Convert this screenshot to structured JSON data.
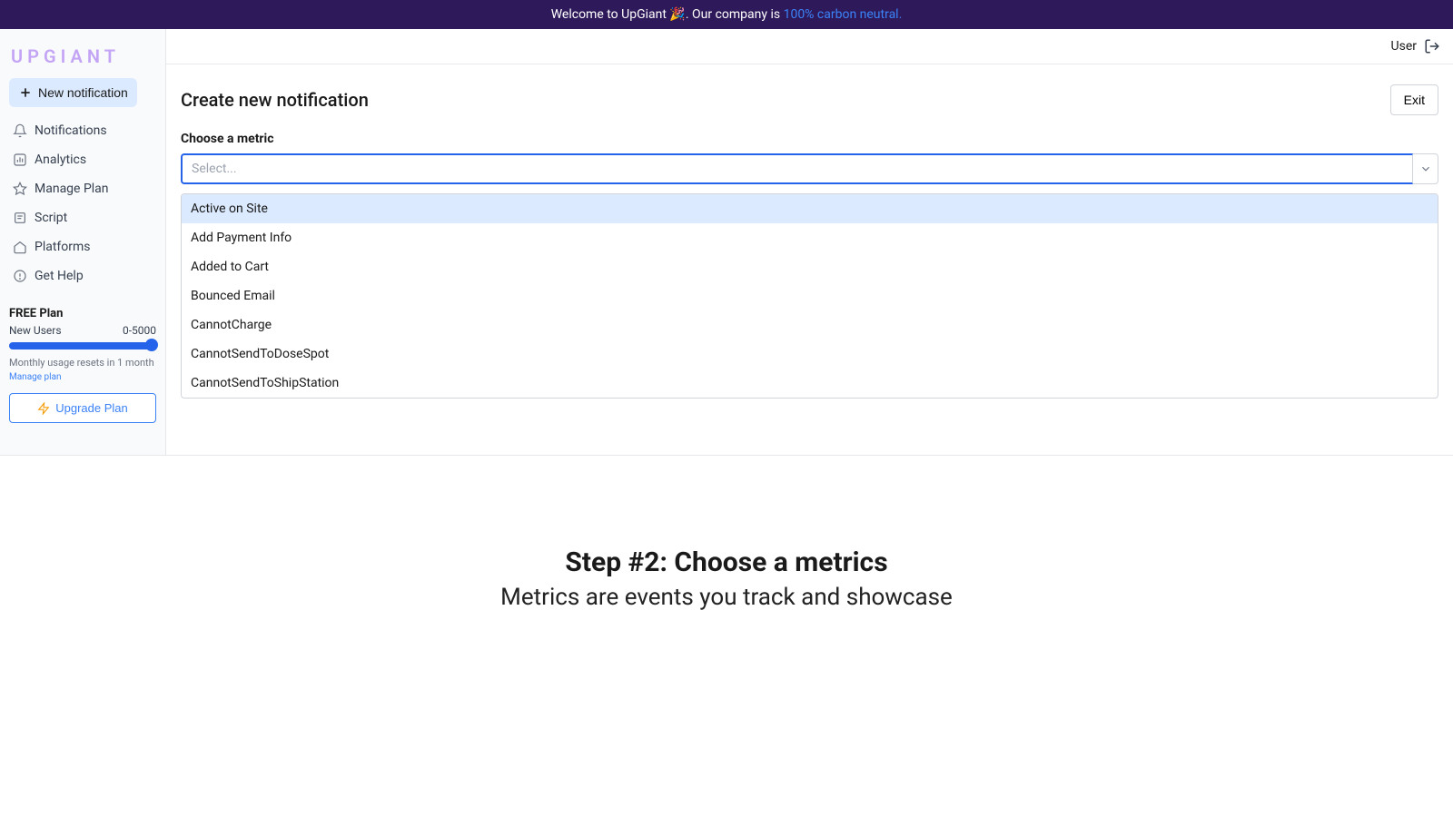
{
  "banner": {
    "text_before": "Welcome to UpGiant 🎉. Our company is ",
    "link": "100% carbon neutral."
  },
  "brand": "UPGIANT",
  "new_button": "New notification",
  "nav": [
    {
      "label": "Notifications"
    },
    {
      "label": "Analytics"
    },
    {
      "label": "Manage Plan"
    },
    {
      "label": "Script"
    },
    {
      "label": "Platforms"
    },
    {
      "label": "Get Help"
    }
  ],
  "plan": {
    "title": "FREE Plan",
    "metric_label": "New Users",
    "metric_range": "0-5000",
    "note": "Monthly usage resets in 1 month",
    "manage": "Manage plan",
    "upgrade": "Upgrade Plan"
  },
  "topbar": {
    "user": "User"
  },
  "page": {
    "title": "Create new notification",
    "exit": "Exit",
    "field_label": "Choose a metric",
    "placeholder": "Select..."
  },
  "options": [
    "Active on Site",
    "Add Payment Info",
    "Added to Cart",
    "Bounced Email",
    "CannotCharge",
    "CannotSendToDoseSpot",
    "CannotSendToShipStation"
  ],
  "tutorial": {
    "title": "Step #2: Choose a metrics",
    "desc": "Metrics are events you track and showcase"
  }
}
